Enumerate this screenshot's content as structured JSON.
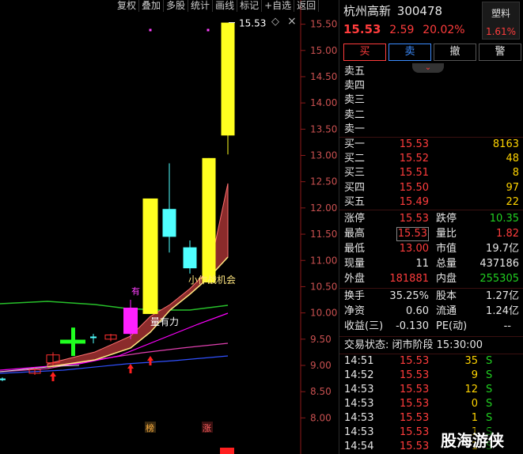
{
  "toolbar": [
    "复权",
    "叠加",
    "多股",
    "统计",
    "画线",
    "标记",
    "+自选",
    "返回"
  ],
  "chart": {
    "price_ticks": [
      "15.50",
      "15.00",
      "14.50",
      "14.00",
      "13.50",
      "13.00",
      "12.50",
      "12.00",
      "11.50",
      "11.00",
      "10.50",
      "10.00",
      "9.50",
      "9.00",
      "8.50",
      "8.00"
    ],
    "last_price_label": "15.53",
    "annotations": {
      "you": "有",
      "opportunity": "小作战机会",
      "strong_volume": "量有力",
      "tag_bang": "榜",
      "tag_zhang": "涨",
      "icon_diamond": "◇",
      "icon_close": "×"
    }
  },
  "chart_data": {
    "type": "candlestick",
    "ylim": [
      7.9,
      15.75
    ],
    "candles": [
      {
        "open": 8.72,
        "close": 8.75,
        "high": 8.77,
        "low": 8.7,
        "color": "cyan"
      },
      {
        "open": 8.85,
        "close": 8.92,
        "high": 8.95,
        "low": 8.82,
        "color": "red"
      },
      {
        "open": 9.05,
        "close": 9.2,
        "high": 9.25,
        "low": 9.0,
        "color": "red"
      },
      {
        "open": 9.45,
        "close": 9.46,
        "high": 9.72,
        "low": 9.18,
        "color": "green"
      },
      {
        "open": 9.5,
        "close": 9.58,
        "high": 9.6,
        "low": 9.46,
        "color": "red"
      },
      {
        "open": 9.55,
        "close": 9.55,
        "high": 9.6,
        "low": 9.42,
        "color": "cyan"
      },
      {
        "open": 9.6,
        "close": 10.1,
        "high": 10.25,
        "low": 9.5,
        "color": "magenta"
      },
      {
        "open": 9.98,
        "close": 12.18,
        "high": 12.18,
        "low": 9.98,
        "color": "yellow"
      },
      {
        "open": 11.98,
        "close": 11.45,
        "high": 12.85,
        "low": 11.15,
        "color": "cyan"
      },
      {
        "open": 11.25,
        "close": 10.85,
        "high": 11.38,
        "low": 10.75,
        "color": "cyan"
      },
      {
        "open": 10.58,
        "close": 12.95,
        "high": 12.95,
        "low": 10.58,
        "color": "yellow"
      },
      {
        "open": 13.38,
        "close": 15.53,
        "high": 15.53,
        "low": 13.02,
        "color": "yellow"
      }
    ]
  },
  "panel": {
    "name": "杭州高新",
    "code": "300478",
    "price": "15.53",
    "change": "2.59",
    "change_pct": "20.02%",
    "sector": "塑料",
    "sector_pct": "1.61%",
    "buttons": [
      "买",
      "卖",
      "撤",
      "警"
    ],
    "sells": [
      {
        "label": "卖五",
        "price": "",
        "vol": ""
      },
      {
        "label": "卖四",
        "price": "",
        "vol": ""
      },
      {
        "label": "卖三",
        "price": "",
        "vol": ""
      },
      {
        "label": "卖二",
        "price": "",
        "vol": ""
      },
      {
        "label": "卖一",
        "price": "",
        "vol": ""
      }
    ],
    "buys": [
      {
        "label": "买一",
        "price": "15.53",
        "vol": "8163"
      },
      {
        "label": "买二",
        "price": "15.52",
        "vol": "48"
      },
      {
        "label": "买三",
        "price": "15.51",
        "vol": "8"
      },
      {
        "label": "买四",
        "price": "15.50",
        "vol": "97"
      },
      {
        "label": "买五",
        "price": "15.49",
        "vol": "22"
      }
    ],
    "quotes": {
      "limit_up_label": "涨停",
      "limit_up": "15.53",
      "limit_down_label": "跌停",
      "limit_down": "10.35",
      "high_label": "最高",
      "high": "15.53",
      "vol_ratio_label": "量比",
      "vol_ratio": "1.82",
      "low_label": "最低",
      "low": "13.00",
      "mkt_cap_label": "市值",
      "mkt_cap": "19.7亿",
      "now_vol_label": "现量",
      "now_vol": "11",
      "total_vol_label": "总量",
      "total_vol": "437186",
      "outer_label": "外盘",
      "outer": "181881",
      "inner_label": "内盘",
      "inner": "255305"
    },
    "stats": {
      "turnover_label": "换手",
      "turnover": "35.25%",
      "share_cap_label": "股本",
      "share_cap": "1.27亿",
      "nav_label": "净资",
      "nav": "0.60",
      "float_label": "流通",
      "float": "1.24亿",
      "eps_label": "收益(三)",
      "eps": "-0.130",
      "pe_label": "PE(动)",
      "pe": "--"
    },
    "status": "交易状态: 闭市阶段 15:30:00",
    "ticks": [
      {
        "time": "14:51",
        "price": "15.53",
        "vol": "35",
        "side": "S"
      },
      {
        "time": "14:52",
        "price": "15.53",
        "vol": "9",
        "side": "S"
      },
      {
        "time": "14:53",
        "price": "15.53",
        "vol": "12",
        "side": "S"
      },
      {
        "time": "14:53",
        "price": "15.53",
        "vol": "0",
        "side": "S"
      },
      {
        "time": "14:53",
        "price": "15.53",
        "vol": "1",
        "side": "S"
      },
      {
        "time": "14:53",
        "price": "15.53",
        "vol": "1",
        "side": "S"
      },
      {
        "time": "14:54",
        "price": "15.53",
        "vol": "1",
        "side": "S"
      }
    ],
    "watermark": "股海游侠"
  }
}
